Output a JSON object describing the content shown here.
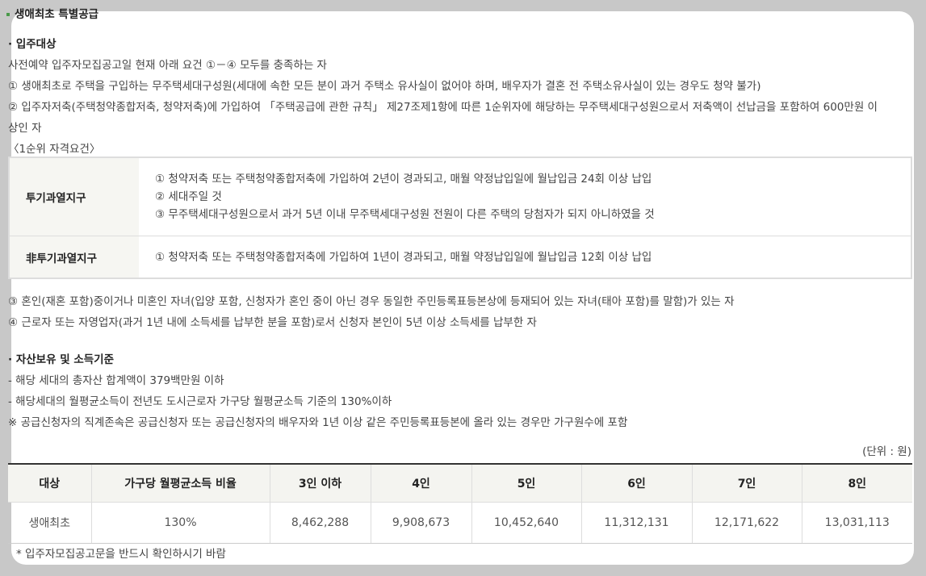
{
  "title": "생애최초 특별공급",
  "eligibility": {
    "heading": "· 입주대상",
    "intro": "사전예약 입주자모집공고일 현재 아래 요건 ①－④ 모두를 충족하는 자",
    "item1": "① 생애최초로 주택을 구입하는 무주택세대구성원(세대에 속한 모든 분이 과거 주택소 유사실이 없어야 하며, 배우자가 결혼 전 주택소유사실이 있는 경우도 청약 불가)",
    "item2a": "② 입주자저축(주택청약종합저축, 청약저축)에 가입하여 「주택공급에 관한 규칙」 제27조제1항에 따른 1순위자에 해당하는 무주택세대구성원으로서 저축액이 선납금을 포함하여 600만원 이",
    "item2b": "상인 자",
    "req_title": "〈1순위 자격요건〉",
    "req_rows": [
      {
        "label": "투기과열지구",
        "lines": [
          "① 청약저축 또는 주택청약종합저축에 가입하여 2년이 경과되고, 매월 약정납입일에 월납입금 24회 이상 납입",
          "② 세대주일 것",
          "③ 무주택세대구성원으로서 과거 5년 이내 무주택세대구성원 전원이 다른 주택의 당첨자가 되지 아니하였을 것"
        ]
      },
      {
        "label": "非투기과열지구",
        "lines": [
          "① 청약저축 또는 주택청약종합저축에 가입하여 1년이 경과되고, 매월 약정납입일에 월납입금 12회 이상 납입"
        ]
      }
    ],
    "item3": "③ 혼인(재혼 포함)중이거나 미혼인 자녀(입양 포함, 신청자가 혼인 중이 아닌 경우 동일한 주민등록표등본상에 등재되어 있는 자녀(태아 포함)를 말함)가 있는 자",
    "item4": "④ 근로자 또는 자영업자(과거 1년 내에 소득세를 납부한 분을 포함)로서 신청자 본인이 5년 이상 소득세를 납부한 자"
  },
  "assets": {
    "heading": "· 자산보유 및 소득기준",
    "line1": "- 해당 세대의 총자산 합계액이 379백만원 이하",
    "line2": "- 해당세대의 월평균소득이 전년도 도시근로자 가구당 월평균소득 기준의 130%이하",
    "note": "※ 공급신청자의 직계존속은 공급신청자 또는 공급신청자의 배우자와 1년 이상 같은 주민등록표등본에 올라 있는 경우만 가구원수에 포함",
    "unit": "(단위 : 원)"
  },
  "income_table": {
    "headers": [
      "대상",
      "가구당 월평균소득 비율",
      "3인 이하",
      "4인",
      "5인",
      "6인",
      "7인",
      "8인"
    ],
    "row": [
      "생애최초",
      "130%",
      "8,462,288",
      "9,908,673",
      "10,452,640",
      "11,312,131",
      "12,171,622",
      "13,031,113"
    ]
  },
  "footnote": "* 입주자모집공고문을 반드시 확인하시기 바람"
}
